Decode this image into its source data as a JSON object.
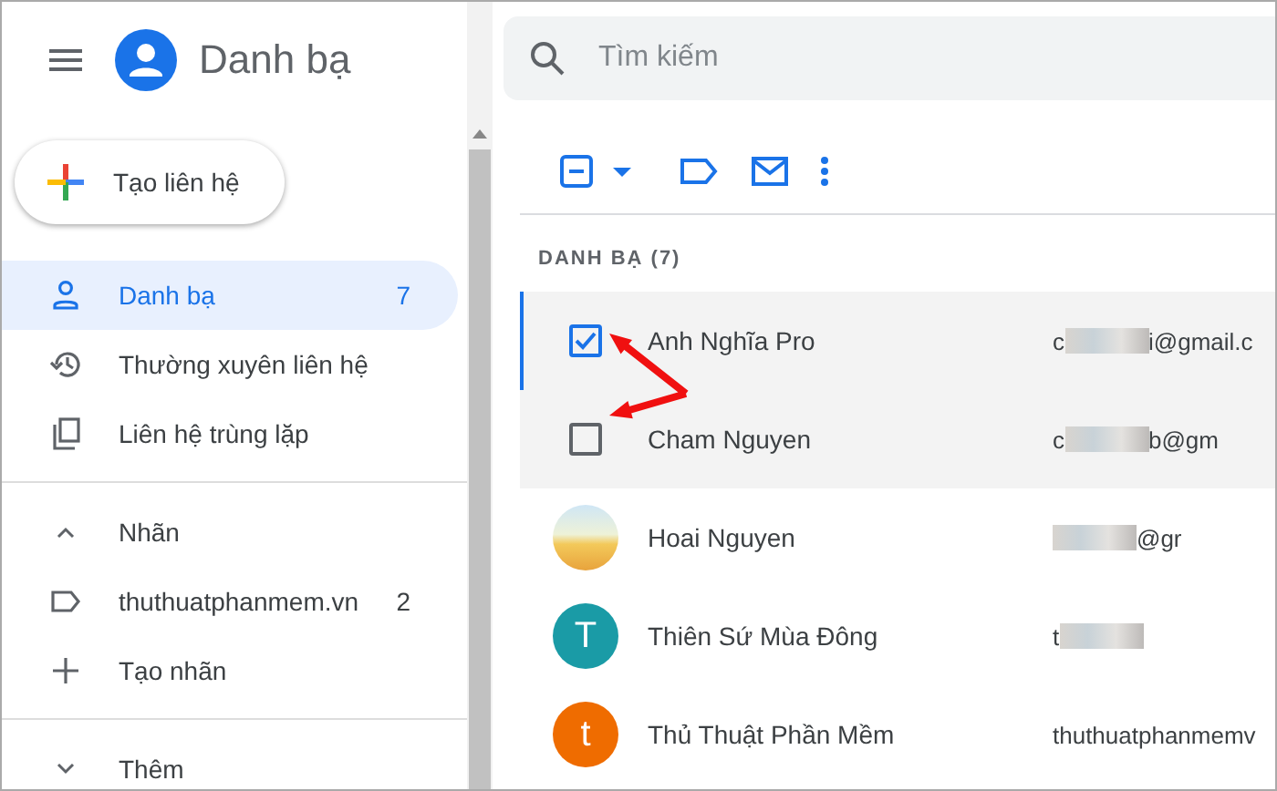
{
  "app": {
    "title": "Danh bạ"
  },
  "search": {
    "placeholder": "Tìm kiếm"
  },
  "create_button": {
    "label": "Tạo liên hệ"
  },
  "sidebar": {
    "items": [
      {
        "kind": "nav",
        "label": "Danh bạ",
        "count": "7",
        "selected": true
      },
      {
        "kind": "nav",
        "label": "Thường xuyên liên hệ",
        "selected": false
      },
      {
        "kind": "nav",
        "label": "Liên hệ trùng lặp",
        "selected": false
      },
      {
        "kind": "divider"
      },
      {
        "kind": "section",
        "label": "Nhãn",
        "expanded": true
      },
      {
        "kind": "nav",
        "label": "thuthuatphanmem.vn",
        "count": "2",
        "selected": false
      },
      {
        "kind": "nav",
        "label": "Tạo nhãn",
        "selected": false
      },
      {
        "kind": "divider"
      },
      {
        "kind": "section",
        "label": "Thêm",
        "expanded": false
      }
    ]
  },
  "list": {
    "heading": "DANH BẠ (7)",
    "rows": [
      {
        "kind": "checkbox",
        "checked": true,
        "selected": true,
        "name": "Anh Nghĩa Pro",
        "email_start": "c",
        "email_end": "i@gmail.c"
      },
      {
        "kind": "checkbox",
        "checked": false,
        "selected": false,
        "name": "Cham Nguyen",
        "email_start": "c",
        "email_end": "b@gm"
      },
      {
        "kind": "photo",
        "selected": false,
        "name": "Hoai Nguyen",
        "email_end": "@gr"
      },
      {
        "kind": "letter",
        "letter": "T",
        "color": "#1a9ba6",
        "selected": false,
        "name": "Thiên Sứ Mùa Đông",
        "email_start": "t"
      },
      {
        "kind": "letter",
        "letter": "t",
        "color": "#ef6c00",
        "selected": false,
        "name": "Thủ Thuật Phần Mềm",
        "email_end": "thuthuatphanmemv"
      }
    ]
  }
}
